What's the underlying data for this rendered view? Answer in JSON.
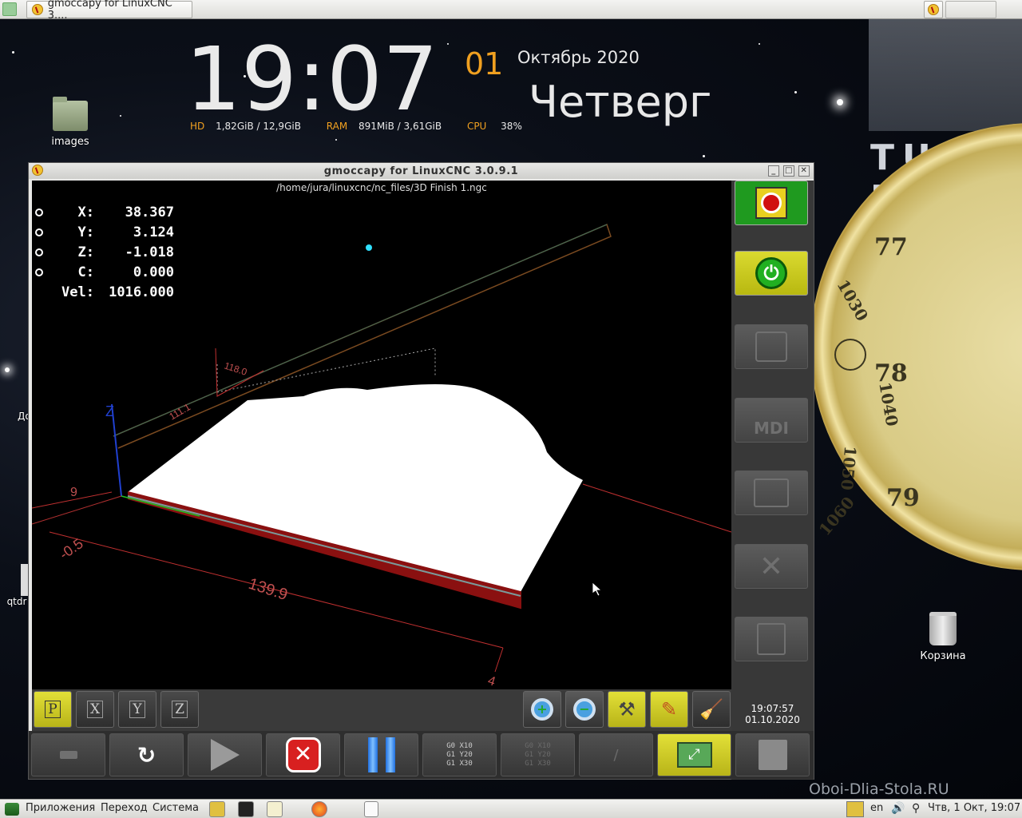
{
  "taskbar_top": {
    "window_button_label": "gmoccapy for LinuxCNC  3...."
  },
  "conky": {
    "time": "19:07",
    "day": "01",
    "month_year": "Октябрь 2020",
    "weekday": "Четверг",
    "hd_label": "HD",
    "hd_value": "1,82GiB / 12,9GiB",
    "ram_label": "RAM",
    "ram_value": "891MiB / 3,61GiB",
    "cpu_label": "CPU",
    "cpu_value": "38%"
  },
  "wallpaper": {
    "brand": "TUX IN",
    "numbers": [
      "77",
      "1030",
      "78",
      "1040",
      "1050",
      "79",
      "1060"
    ],
    "watermark": "Oboi-Dlia-Stola.RU"
  },
  "desktop_icons": {
    "images": "images",
    "trash": "Корзина",
    "partial_left_1": "До",
    "partial_left_2": "qtdr"
  },
  "window": {
    "title": "gmoccapy for LinuxCNC  3.0.9.1",
    "file_path": "/home/jura/linuxcnc/nc_files/3D Finish 1.ngc",
    "dro": [
      {
        "axis": "X:",
        "value": "38.367"
      },
      {
        "axis": "Y:",
        "value": "3.124"
      },
      {
        "axis": "Z:",
        "value": "-1.018"
      },
      {
        "axis": "C:",
        "value": "0.000"
      }
    ],
    "vel_label": "Vel:",
    "vel_value": "1016.000",
    "dimension_labels": {
      "d1": "118.0",
      "d2": "111.1",
      "d3": "139.9",
      "d4": "-0.5",
      "d5": "9",
      "d6": "4",
      "z_axis": "Z"
    },
    "view_buttons": [
      "P",
      "X",
      "Y",
      "Z"
    ],
    "clock_time": "19:07:57",
    "clock_date": "01.10.2020",
    "mdi_label": "MDI",
    "gcode_lines": [
      "G0 X10",
      "G1 Y20",
      "G1 X30"
    ]
  },
  "taskbar_bottom": {
    "menu_apps": "Приложения",
    "menu_places": "Переход",
    "menu_system": "Система",
    "lang": "en",
    "datetime": "Чтв,  1 Окт, 19:07"
  },
  "colors": {
    "estop_green": "#1f9a1f",
    "power_yellow": "#c8c81e",
    "clock_accent": "#f0a020",
    "active_button": "#d4d230"
  }
}
